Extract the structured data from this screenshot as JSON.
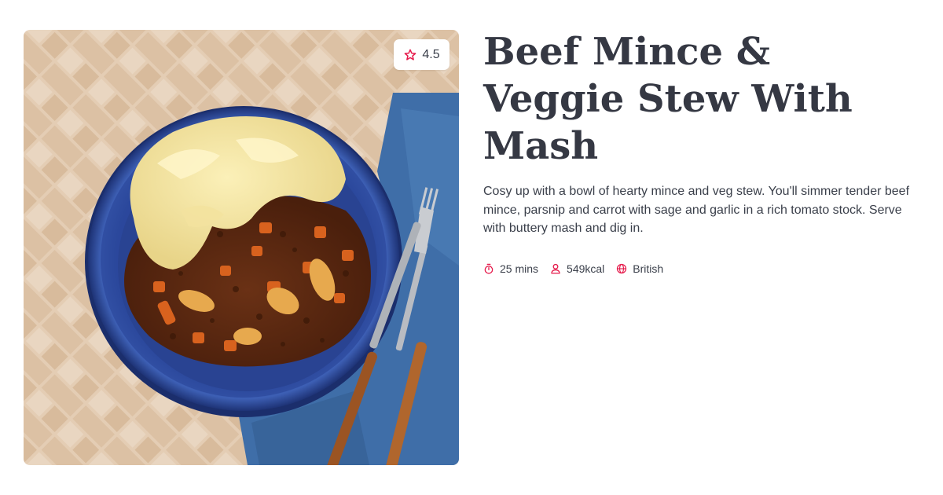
{
  "recipe": {
    "title": "Beef Mince & Veggie Stew With Mash",
    "description": "Cosy up with a bowl of hearty mince and veg stew. You'll simmer tender beef mince, parsnip and carrot with sage and garlic in a rich tomato stock. Serve with buttery mash and dig in.",
    "rating": "4.5",
    "meta": {
      "time": "25 mins",
      "calories": "549kcal",
      "cuisine": "British"
    },
    "icons": {
      "rating": "star-outline-icon",
      "time": "stopwatch-icon",
      "calories": "person-icon",
      "cuisine": "globe-icon"
    }
  },
  "colors": {
    "accent": "#e5194a",
    "title": "#353843",
    "text": "#3a3f4a"
  }
}
